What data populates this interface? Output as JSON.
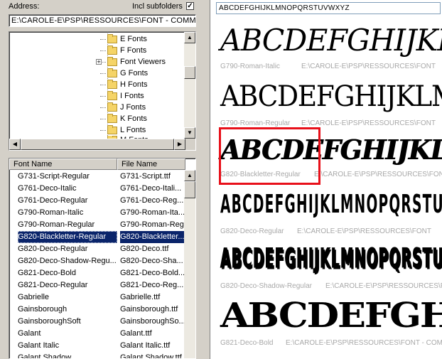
{
  "address": {
    "label": "Address:",
    "value": "E:\\CAROLE-E\\PSP\\RESSOURCES\\FONT - COMMER"
  },
  "subfolders": {
    "label": "Incl subfolders",
    "checked": true,
    "mark": "✓"
  },
  "tree": {
    "items": [
      {
        "label": "E Fonts"
      },
      {
        "label": "F Fonts"
      },
      {
        "label": "Font Viewers",
        "expandable": true
      },
      {
        "label": "G Fonts"
      },
      {
        "label": "H Fonts"
      },
      {
        "label": "I Fonts"
      },
      {
        "label": "J Fonts"
      },
      {
        "label": "K Fonts"
      },
      {
        "label": "L Fonts"
      },
      {
        "label": "M Fonts"
      }
    ]
  },
  "list": {
    "columns": [
      "Font Name",
      "File Name"
    ],
    "rows": [
      {
        "name": "G731-Script-Regular",
        "file": "G731-Script.ttf"
      },
      {
        "name": "G761-Deco-Italic",
        "file": "G761-Deco-Itali..."
      },
      {
        "name": "G761-Deco-Regular",
        "file": "G761-Deco-Reg..."
      },
      {
        "name": "G790-Roman-Italic",
        "file": "G790-Roman-Ita..."
      },
      {
        "name": "G790-Roman-Regular",
        "file": "G790-Roman-Reg..."
      },
      {
        "name": "G820-Blackletter-Regular",
        "file": "G820-Blackletter...",
        "selected": true
      },
      {
        "name": "G820-Deco-Regular",
        "file": "G820-Deco.ttf"
      },
      {
        "name": "G820-Deco-Shadow-Regu...",
        "file": "G820-Deco-Sha..."
      },
      {
        "name": "G821-Deco-Bold",
        "file": "G821-Deco-Bold..."
      },
      {
        "name": "G821-Deco-Regular",
        "file": "G821-Deco-Reg..."
      },
      {
        "name": "Gabrielle",
        "file": "Gabrielle.ttf"
      },
      {
        "name": "Gainsborough",
        "file": "Gainsborough.ttf"
      },
      {
        "name": "GainsboroughSoft",
        "file": "GainsboroughSo..."
      },
      {
        "name": "Galant",
        "file": "Galant.ttf"
      },
      {
        "name": "Galant Italic",
        "file": "Galant Italic.ttf"
      },
      {
        "name": "Galant Shadow",
        "file": "Galant Shadow.ttf"
      }
    ]
  },
  "preview": {
    "sample_text": "ABCDEFGHIJKLMNOPQRSTUVWXYZ",
    "items": [
      {
        "sample": "ABCDEFGHIJKLMNOPQRSTUVWXYZ",
        "font": "G790-Roman-Italic",
        "path": "E:\\CAROLE-E\\PSP\\RESSOURCES\\FONT"
      },
      {
        "sample": "ABCDEFGHIJKLMNOPQRSTUVWXYZ",
        "font": "G790-Roman-Regular",
        "path": "E:\\CAROLE-E\\PSP\\RESSOURCES\\FONT"
      },
      {
        "sample": "ABCDEFGHIJKLMNOPQRSTUVWXYZ",
        "font": "G820-Blackletter-Regular",
        "path": "E:\\CAROLE-E\\PSP\\RESSOURCES\\FONT"
      },
      {
        "sample": "ABCDEFGHIJKLMNOPQRSTUVWXYZ",
        "font": "G820-Deco-Regular",
        "path": "E:\\CAROLE-E\\PSP\\RESSOURCES\\FONT"
      },
      {
        "sample": "ABCDEFGHIJKLMNOPQRSTUVWXYZ",
        "font": "G820-Deco-Shadow-Regular",
        "path": "E:\\CAROLE-E\\PSP\\RESSOURCES\\FONT"
      },
      {
        "sample": "ABCDEFGHIJKLMNOPQRSTUVWXYZ",
        "font": "G821-Deco-Bold",
        "path": "E:\\CAROLE-E\\PSP\\RESSOURCES\\FONT - COMME"
      }
    ]
  },
  "highlight": {
    "color": "#e8101a",
    "target": "G820-Blackletter-Regular"
  },
  "colors": {
    "selection": "#0a246a",
    "caption": "#a8a8a8",
    "panel": "#d4d0c8"
  }
}
